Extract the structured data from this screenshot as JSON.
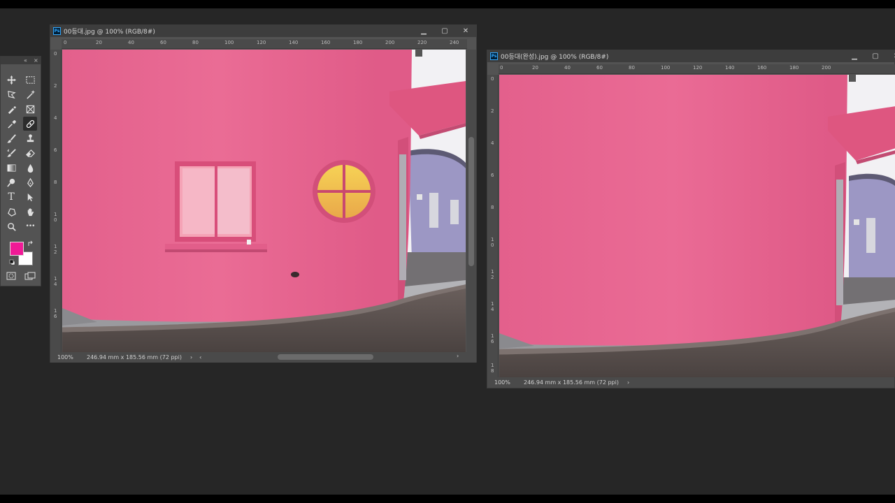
{
  "doc1": {
    "title": "00등대.jpg @ 100% (RGB/8#)",
    "zoom": "100%",
    "dimensions": "246.94 mm x 185.56 mm (72 ppi)",
    "ruler_h": [
      "0",
      "20",
      "40",
      "60",
      "80",
      "100",
      "120",
      "140",
      "160",
      "180",
      "200",
      "220",
      "240"
    ],
    "ruler_v": [
      "0",
      "2",
      "4",
      "6",
      "8",
      "1 0",
      "1 2",
      "1 4",
      "1 6"
    ]
  },
  "doc2": {
    "title": "00등대(완성).jpg @ 100% (RGB/8#)",
    "zoom": "100%",
    "dimensions": "246.94 mm x 185.56 mm (72 ppi)",
    "ruler_h": [
      "0",
      "20",
      "40",
      "60",
      "80",
      "100",
      "120",
      "140",
      "160",
      "180",
      "200"
    ],
    "ruler_v": [
      "0",
      "2",
      "4",
      "6",
      "8",
      "1 0",
      "1 2",
      "1 4",
      "1 6",
      "1 8"
    ]
  },
  "toolbar": {
    "collapse_glyph": "«",
    "close_glyph": "×",
    "tools": [
      "move-tool",
      "rect-marquee-tool",
      "lasso-tool",
      "magic-wand-tool",
      "brush-select-tool",
      "frame-tool",
      "eyedropper-tool",
      "healing-brush-tool",
      "brush-tool",
      "clone-stamp-tool",
      "history-brush-tool",
      "eraser-tool",
      "gradient-tool",
      "blur-tool",
      "dodge-tool",
      "pen-tool",
      "type-tool",
      "path-select-tool",
      "shape-tool",
      "hand-tool",
      "zoom-tool",
      "more-tools"
    ],
    "type_glyph": "T",
    "more_glyph": "•••",
    "foreground_color": "#f01a96",
    "background_color": "#ffffff"
  },
  "window_glyphs": {
    "minimize": "▁",
    "maximize": "▢",
    "close": "✕",
    "status_arrow": "›",
    "scroll_left": "‹",
    "scroll_right": "›"
  },
  "colors": {
    "workspace": "#262626",
    "panel": "#535353",
    "building_pink": "#e8638e",
    "annex_purple": "#9c97c4"
  }
}
